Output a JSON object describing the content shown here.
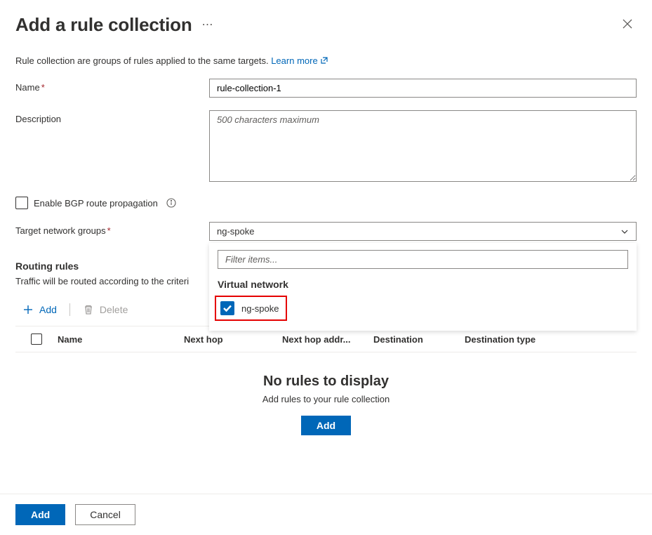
{
  "header": {
    "title": "Add a rule collection"
  },
  "intro": {
    "text": "Rule collection are groups of rules applied to the same targets. ",
    "learn_more": "Learn more"
  },
  "fields": {
    "name": {
      "label": "Name",
      "value": "rule-collection-1"
    },
    "description": {
      "label": "Description",
      "placeholder": "500 characters maximum",
      "value": ""
    },
    "bgp": {
      "label": "Enable BGP route propagation"
    },
    "target": {
      "label": "Target network groups",
      "value": "ng-spoke"
    }
  },
  "dropdown": {
    "filter_placeholder": "Filter items...",
    "group_label": "Virtual network",
    "options": [
      {
        "label": "ng-spoke",
        "checked": true
      }
    ]
  },
  "rules": {
    "heading": "Routing rules",
    "subtext": "Traffic will be routed according to the criteri",
    "add_label": "Add",
    "delete_label": "Delete",
    "columns": {
      "name": "Name",
      "next_hop": "Next hop",
      "next_hop_addr": "Next hop addr...",
      "destination": "Destination",
      "destination_type": "Destination type"
    },
    "empty": {
      "title": "No rules to display",
      "sub": "Add rules to your rule collection",
      "button": "Add"
    }
  },
  "footer": {
    "add": "Add",
    "cancel": "Cancel"
  }
}
